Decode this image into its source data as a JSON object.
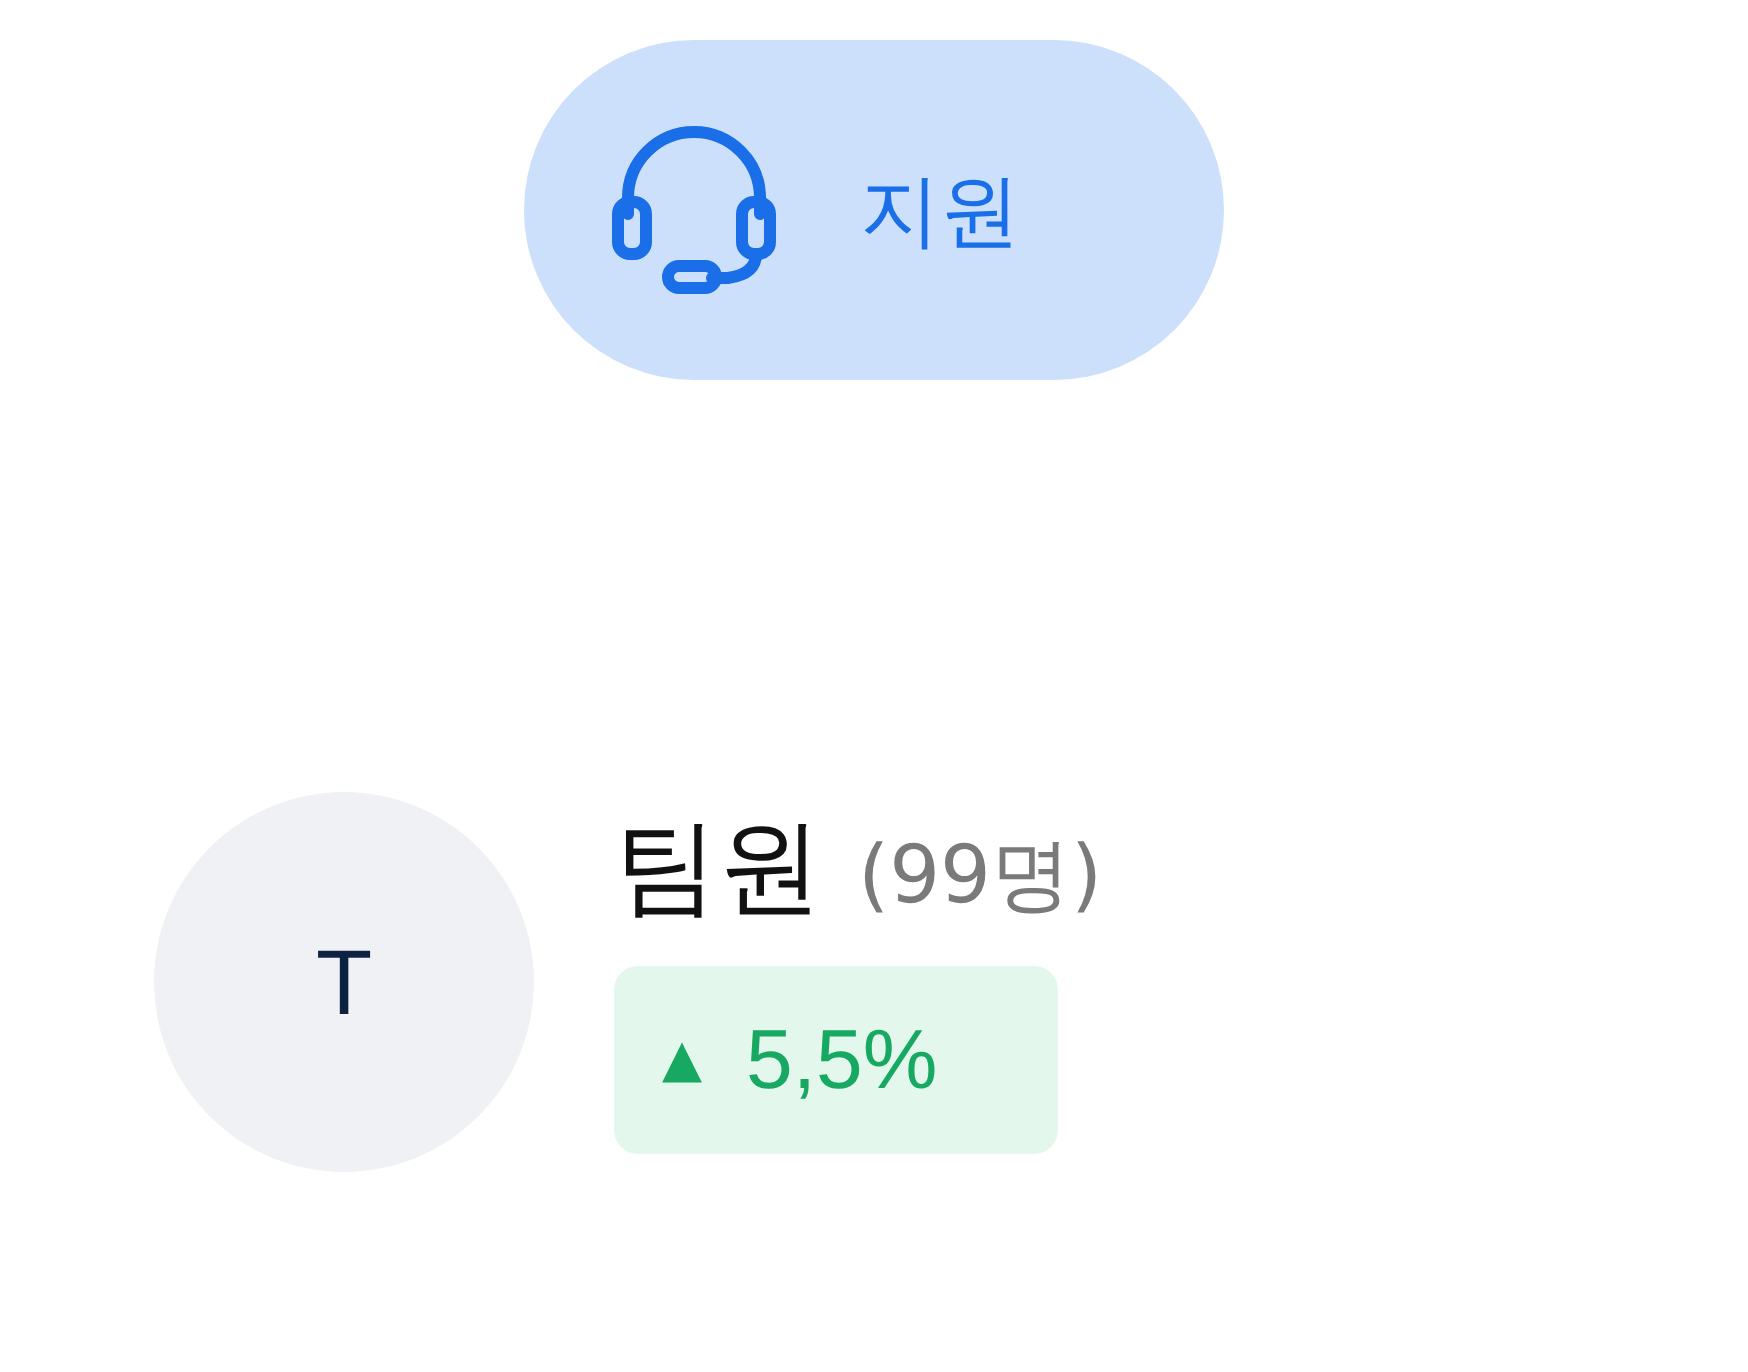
{
  "support_button": {
    "label": "지원"
  },
  "member": {
    "avatar": "T",
    "title": "팀원",
    "count": "(99명)",
    "change": {
      "kind": "up",
      "arrow": "▲",
      "value": "5,5%"
    }
  }
}
